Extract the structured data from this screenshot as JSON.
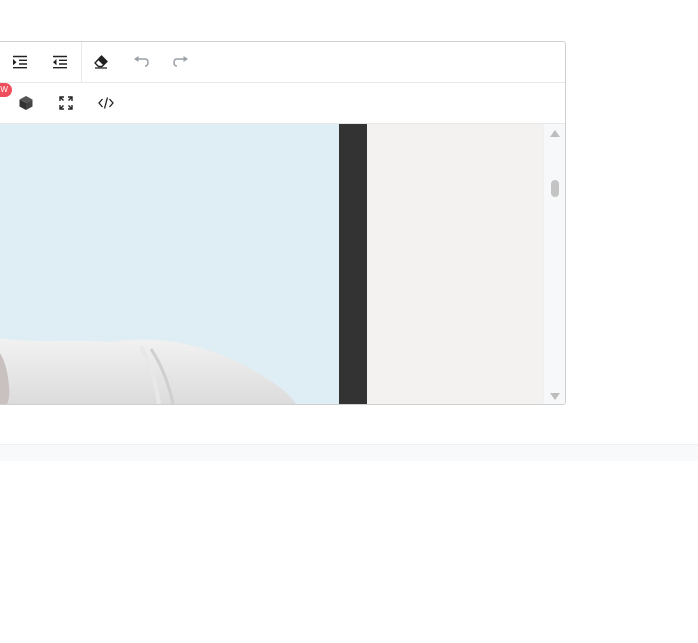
{
  "toolbar": {
    "row1": [
      {
        "name": "indent-icon"
      },
      {
        "name": "outdent-icon"
      },
      {
        "name": "eraser-icon"
      },
      {
        "name": "undo-icon"
      },
      {
        "name": "redo-icon"
      }
    ],
    "row2": [
      {
        "name": "3d-box-icon",
        "badge": "EW"
      },
      {
        "name": "fullscreen-icon"
      },
      {
        "name": "code-view-icon"
      }
    ]
  },
  "colors": {
    "badge": "#ef4f5c",
    "image_background": "#dfedf4",
    "dark_strip": "#333333",
    "light_panel": "#f3f2f0"
  },
  "scroll": {
    "position_fraction": 0.2
  }
}
